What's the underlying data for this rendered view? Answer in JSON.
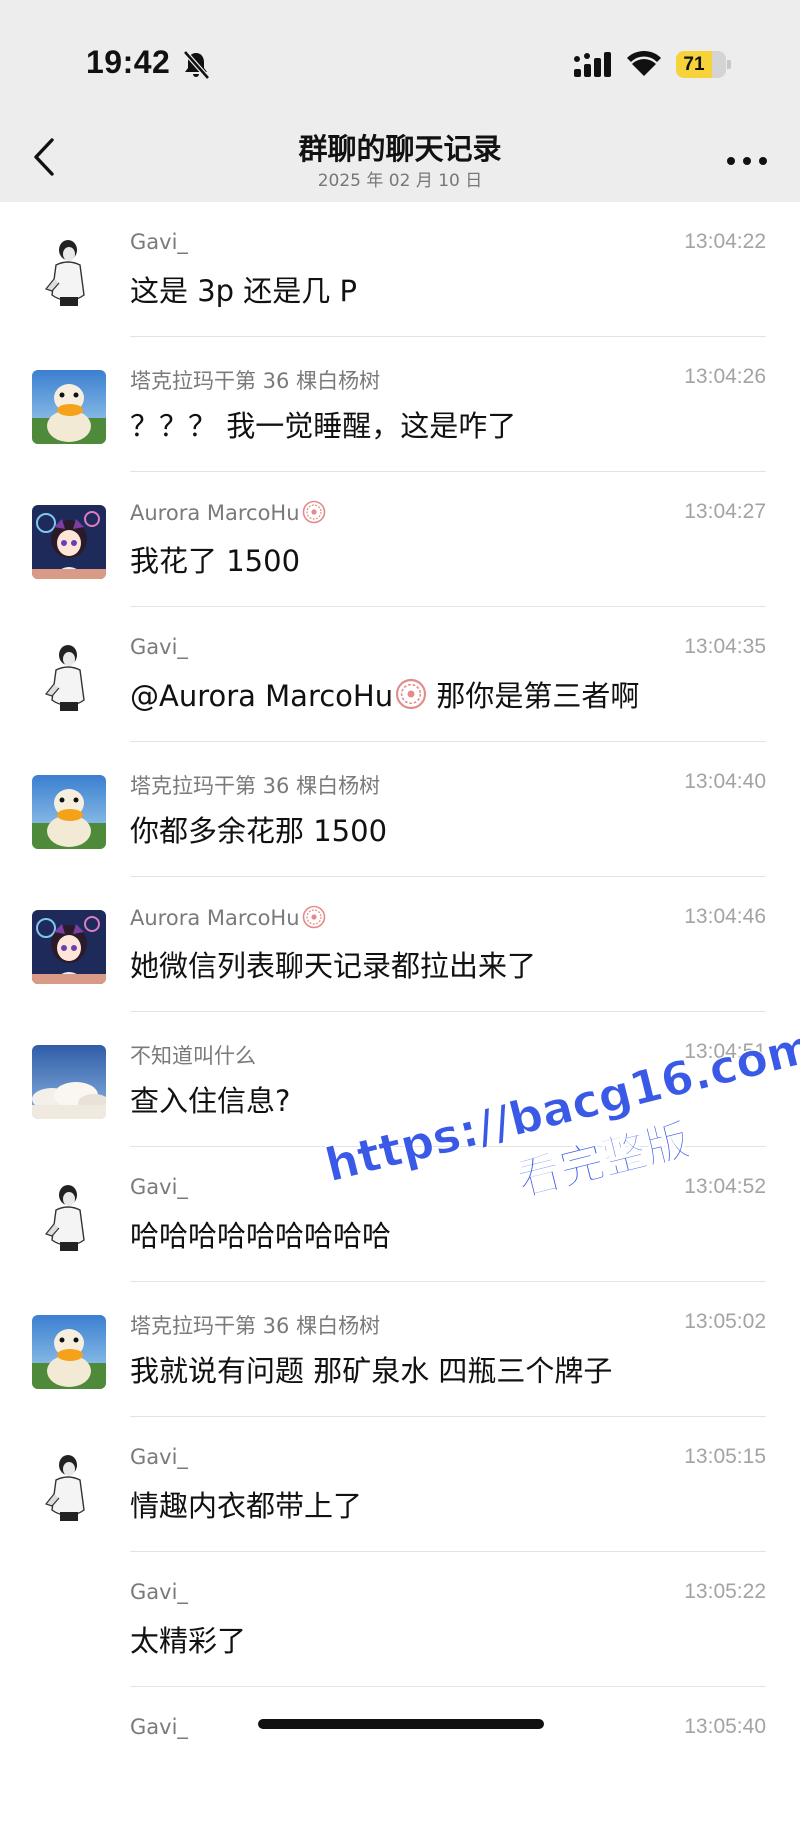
{
  "status_bar": {
    "time": "19:42",
    "battery_level": "71",
    "battery_percent": 71
  },
  "nav": {
    "title": "群聊的聊天记录",
    "subtitle": "2025 年 02 月 10 日",
    "back_icon": "chevron-left-icon",
    "more_icon": "more-dots-icon"
  },
  "messages": [
    {
      "sender": "Gavi_",
      "time": "13:04:22",
      "text": "这是 3p 还是几 P",
      "avatar": "gavi"
    },
    {
      "sender": "塔克拉玛干第 36 棵白杨树",
      "time": "13:04:26",
      "text": "？？？  我一觉睡醒，这是咋了",
      "avatar": "duck"
    },
    {
      "sender": "Aurora MarcoHu",
      "time": "13:04:27",
      "text": "我花了 1500",
      "avatar": "anime",
      "badge": true
    },
    {
      "sender": "Gavi_",
      "time": "13:04:35",
      "mention": "@Aurora MarcoHu",
      "text": " 那你是第三者啊",
      "avatar": "gavi"
    },
    {
      "sender": "塔克拉玛干第 36 棵白杨树",
      "time": "13:04:40",
      "text": "你都多余花那 1500",
      "avatar": "duck"
    },
    {
      "sender": "Aurora MarcoHu",
      "time": "13:04:46",
      "text": "她微信列表聊天记录都拉出来了",
      "avatar": "anime",
      "badge": true
    },
    {
      "sender": "不知道叫什么",
      "time": "13:04:51",
      "text": "查入住信息?",
      "avatar": "sky"
    },
    {
      "sender": "Gavi_",
      "time": "13:04:52",
      "text": "哈哈哈哈哈哈哈哈哈",
      "avatar": "gavi"
    },
    {
      "sender": "塔克拉玛干第 36 棵白杨树",
      "time": "13:05:02",
      "text": "我就说有问题 那矿泉水 四瓶三个牌子",
      "avatar": "duck"
    },
    {
      "sender": "Gavi_",
      "time": "13:05:15",
      "text": "情趣内衣都带上了",
      "avatar": "gavi"
    },
    {
      "sender": "Gavi_",
      "time": "13:05:22",
      "text": "太精彩了",
      "avatar": "none"
    },
    {
      "sender": "Gavi_",
      "time": "13:05:40",
      "text": "",
      "avatar": "none"
    }
  ],
  "watermark": {
    "url": "https://bacg16.com",
    "label": "看完整版"
  },
  "colors": {
    "header_bg": "#ededed",
    "battery_fill": "#f6d23b",
    "watermark": "#3a59e6",
    "badge": "#e58a8a"
  }
}
